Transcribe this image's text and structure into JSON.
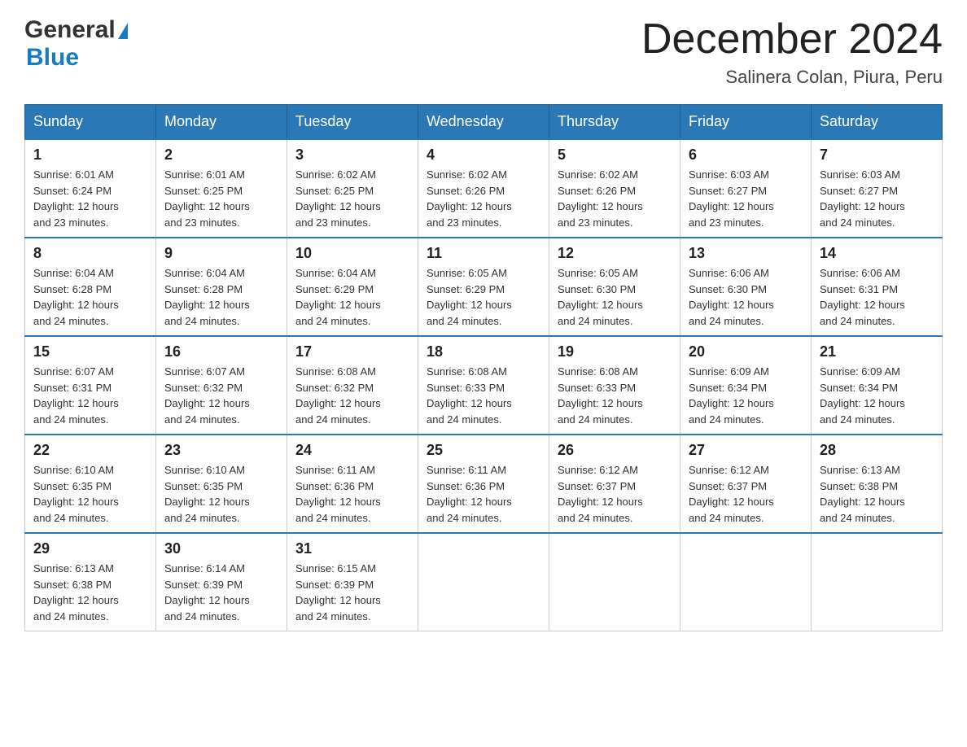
{
  "header": {
    "logo_general": "General",
    "logo_blue": "Blue",
    "month_title": "December 2024",
    "location": "Salinera Colan, Piura, Peru"
  },
  "days_of_week": [
    "Sunday",
    "Monday",
    "Tuesday",
    "Wednesday",
    "Thursday",
    "Friday",
    "Saturday"
  ],
  "weeks": [
    [
      {
        "day": "1",
        "sunrise": "6:01 AM",
        "sunset": "6:24 PM",
        "daylight": "12 hours and 23 minutes."
      },
      {
        "day": "2",
        "sunrise": "6:01 AM",
        "sunset": "6:25 PM",
        "daylight": "12 hours and 23 minutes."
      },
      {
        "day": "3",
        "sunrise": "6:02 AM",
        "sunset": "6:25 PM",
        "daylight": "12 hours and 23 minutes."
      },
      {
        "day": "4",
        "sunrise": "6:02 AM",
        "sunset": "6:26 PM",
        "daylight": "12 hours and 23 minutes."
      },
      {
        "day": "5",
        "sunrise": "6:02 AM",
        "sunset": "6:26 PM",
        "daylight": "12 hours and 23 minutes."
      },
      {
        "day": "6",
        "sunrise": "6:03 AM",
        "sunset": "6:27 PM",
        "daylight": "12 hours and 23 minutes."
      },
      {
        "day": "7",
        "sunrise": "6:03 AM",
        "sunset": "6:27 PM",
        "daylight": "12 hours and 24 minutes."
      }
    ],
    [
      {
        "day": "8",
        "sunrise": "6:04 AM",
        "sunset": "6:28 PM",
        "daylight": "12 hours and 24 minutes."
      },
      {
        "day": "9",
        "sunrise": "6:04 AM",
        "sunset": "6:28 PM",
        "daylight": "12 hours and 24 minutes."
      },
      {
        "day": "10",
        "sunrise": "6:04 AM",
        "sunset": "6:29 PM",
        "daylight": "12 hours and 24 minutes."
      },
      {
        "day": "11",
        "sunrise": "6:05 AM",
        "sunset": "6:29 PM",
        "daylight": "12 hours and 24 minutes."
      },
      {
        "day": "12",
        "sunrise": "6:05 AM",
        "sunset": "6:30 PM",
        "daylight": "12 hours and 24 minutes."
      },
      {
        "day": "13",
        "sunrise": "6:06 AM",
        "sunset": "6:30 PM",
        "daylight": "12 hours and 24 minutes."
      },
      {
        "day": "14",
        "sunrise": "6:06 AM",
        "sunset": "6:31 PM",
        "daylight": "12 hours and 24 minutes."
      }
    ],
    [
      {
        "day": "15",
        "sunrise": "6:07 AM",
        "sunset": "6:31 PM",
        "daylight": "12 hours and 24 minutes."
      },
      {
        "day": "16",
        "sunrise": "6:07 AM",
        "sunset": "6:32 PM",
        "daylight": "12 hours and 24 minutes."
      },
      {
        "day": "17",
        "sunrise": "6:08 AM",
        "sunset": "6:32 PM",
        "daylight": "12 hours and 24 minutes."
      },
      {
        "day": "18",
        "sunrise": "6:08 AM",
        "sunset": "6:33 PM",
        "daylight": "12 hours and 24 minutes."
      },
      {
        "day": "19",
        "sunrise": "6:08 AM",
        "sunset": "6:33 PM",
        "daylight": "12 hours and 24 minutes."
      },
      {
        "day": "20",
        "sunrise": "6:09 AM",
        "sunset": "6:34 PM",
        "daylight": "12 hours and 24 minutes."
      },
      {
        "day": "21",
        "sunrise": "6:09 AM",
        "sunset": "6:34 PM",
        "daylight": "12 hours and 24 minutes."
      }
    ],
    [
      {
        "day": "22",
        "sunrise": "6:10 AM",
        "sunset": "6:35 PM",
        "daylight": "12 hours and 24 minutes."
      },
      {
        "day": "23",
        "sunrise": "6:10 AM",
        "sunset": "6:35 PM",
        "daylight": "12 hours and 24 minutes."
      },
      {
        "day": "24",
        "sunrise": "6:11 AM",
        "sunset": "6:36 PM",
        "daylight": "12 hours and 24 minutes."
      },
      {
        "day": "25",
        "sunrise": "6:11 AM",
        "sunset": "6:36 PM",
        "daylight": "12 hours and 24 minutes."
      },
      {
        "day": "26",
        "sunrise": "6:12 AM",
        "sunset": "6:37 PM",
        "daylight": "12 hours and 24 minutes."
      },
      {
        "day": "27",
        "sunrise": "6:12 AM",
        "sunset": "6:37 PM",
        "daylight": "12 hours and 24 minutes."
      },
      {
        "day": "28",
        "sunrise": "6:13 AM",
        "sunset": "6:38 PM",
        "daylight": "12 hours and 24 minutes."
      }
    ],
    [
      {
        "day": "29",
        "sunrise": "6:13 AM",
        "sunset": "6:38 PM",
        "daylight": "12 hours and 24 minutes."
      },
      {
        "day": "30",
        "sunrise": "6:14 AM",
        "sunset": "6:39 PM",
        "daylight": "12 hours and 24 minutes."
      },
      {
        "day": "31",
        "sunrise": "6:15 AM",
        "sunset": "6:39 PM",
        "daylight": "12 hours and 24 minutes."
      },
      null,
      null,
      null,
      null
    ]
  ],
  "labels": {
    "sunrise": "Sunrise:",
    "sunset": "Sunset:",
    "daylight": "Daylight:"
  }
}
